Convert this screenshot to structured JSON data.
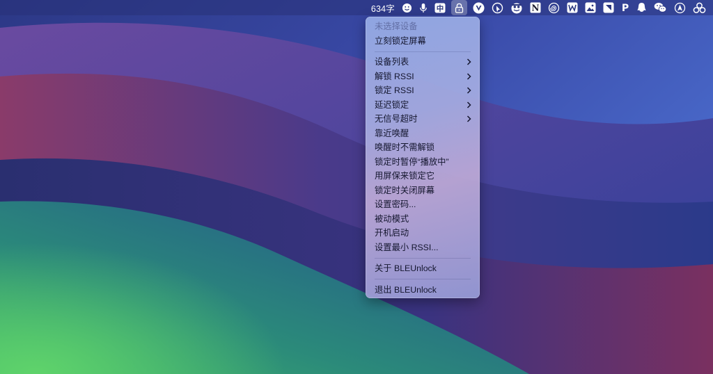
{
  "colors": {
    "menubar_text": "#ffffff",
    "menu_text": "#14162e",
    "menu_disabled": "#8a8fb8"
  },
  "menubar": {
    "word_count": "634字",
    "icons": [
      "emoji-icon",
      "microphone-icon",
      "chinese-input-icon",
      "lock-icon",
      "vpn-icon",
      "cursor-icon",
      "mascot-icon",
      "notion-icon",
      "spiral-icon",
      "wps-icon",
      "photo-icon",
      "kite-icon",
      "p-icon",
      "qq-icon",
      "wechat-icon",
      "navigation-icon",
      "cluster-icon"
    ],
    "notion_glyph": "N",
    "p_glyph": "P",
    "chinese_glyph": "中"
  },
  "dropdown": {
    "no_device": "未选择设备",
    "lock_now": "立刻锁定屏幕",
    "device_list": "设备列表",
    "unlock_rssi": "解锁 RSSI",
    "lock_rssi": "锁定 RSSI",
    "lock_delay": "延迟锁定",
    "no_signal_timeout": "无信号超时",
    "wake_on_proximity": "靠近唤醒",
    "wake_without_unlock": "唤醒时不需解锁",
    "pause_now_playing": "锁定时暂停“播放中”",
    "use_screensaver": "用屏保来锁定它",
    "turn_off_screen": "锁定时关闭屏幕",
    "set_password": "设置密码...",
    "passive_mode": "被动模式",
    "launch_at_login": "开机启动",
    "set_min_rssi": "设置最小 RSSI...",
    "about": "关于 BLEUnlock",
    "quit": "退出 BLEUnlock"
  }
}
